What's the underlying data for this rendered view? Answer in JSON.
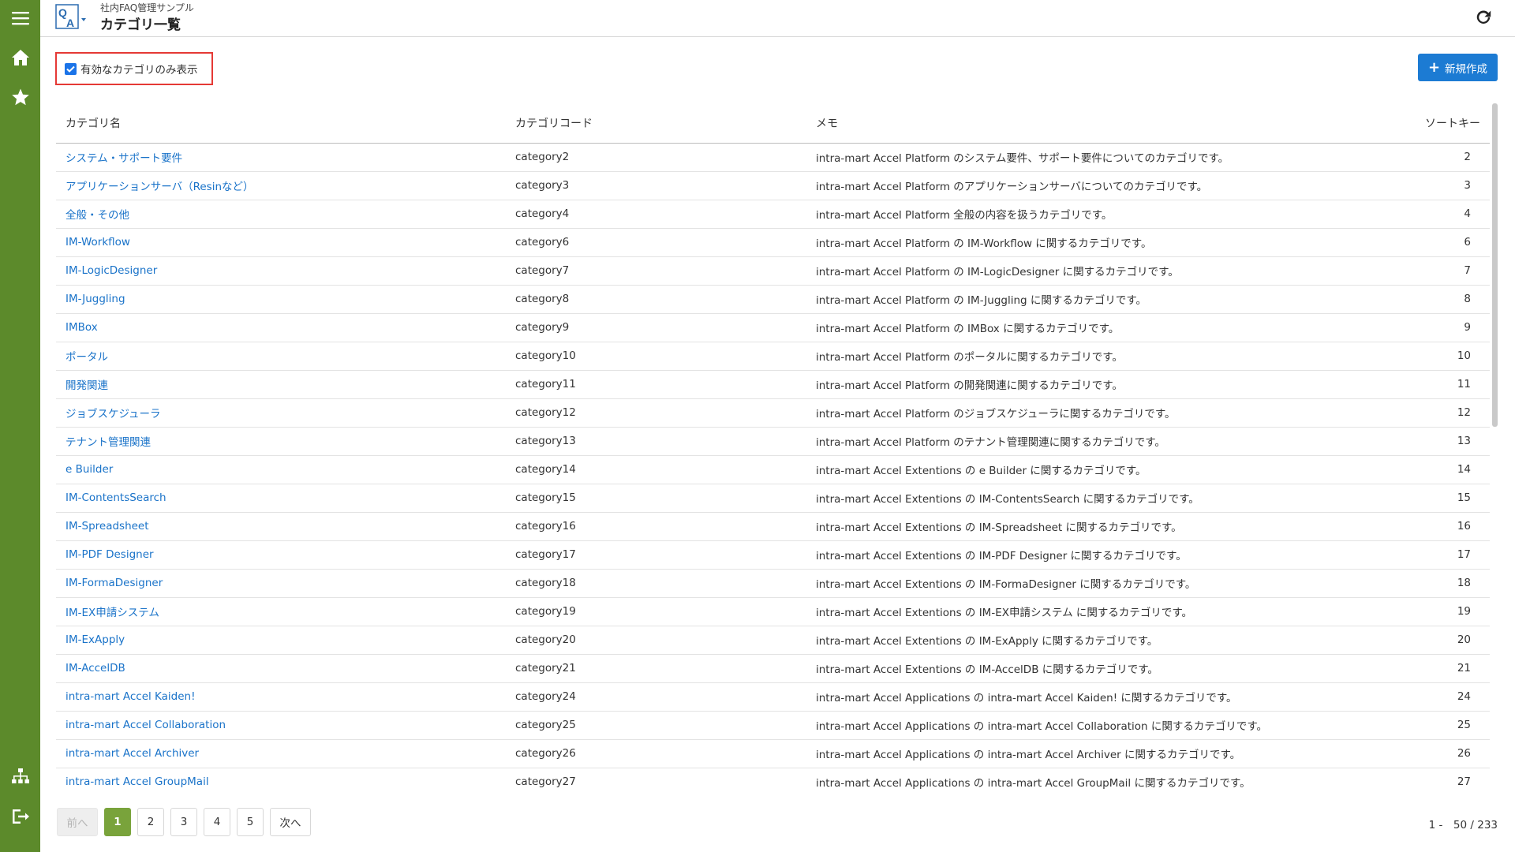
{
  "header": {
    "subtitle": "社内FAQ管理サンプル",
    "title": "カテゴリ一覧",
    "logo_text_q": "Q",
    "logo_text_a": "A"
  },
  "sidebar": {
    "items": [
      {
        "name": "menu-icon"
      },
      {
        "name": "home-icon"
      },
      {
        "name": "star-icon"
      },
      {
        "name": "sitemap-icon"
      },
      {
        "name": "logout-icon"
      }
    ],
    "color": "#5c8a2b"
  },
  "filter": {
    "label": "有効なカテゴリのみ表示",
    "checked": true
  },
  "toolbar": {
    "new_label": "新規作成",
    "accent": "#1c7bd3"
  },
  "table": {
    "headers": {
      "name": "カテゴリ名",
      "code": "カテゴリコード",
      "memo": "メモ",
      "sort": "ソートキー"
    },
    "rows": [
      {
        "name": "システム・サポート要件",
        "code": "category2",
        "memo": "intra-mart Accel Platform のシステム要件、サポート要件についてのカテゴリです。",
        "sort": "2"
      },
      {
        "name": "アプリケーションサーバ（Resinなど）",
        "code": "category3",
        "memo": "intra-mart Accel Platform のアプリケーションサーバについてのカテゴリです。",
        "sort": "3"
      },
      {
        "name": "全般・その他",
        "code": "category4",
        "memo": "intra-mart Accel Platform 全般の内容を扱うカテゴリです。",
        "sort": "4"
      },
      {
        "name": "IM-Workflow",
        "code": "category6",
        "memo": "intra-mart Accel Platform の IM-Workflow に関するカテゴリです。",
        "sort": "6"
      },
      {
        "name": "IM-LogicDesigner",
        "code": "category7",
        "memo": "intra-mart Accel Platform の IM-LogicDesigner に関するカテゴリです。",
        "sort": "7"
      },
      {
        "name": "IM-Juggling",
        "code": "category8",
        "memo": "intra-mart Accel Platform の IM-Juggling に関するカテゴリです。",
        "sort": "8"
      },
      {
        "name": "IMBox",
        "code": "category9",
        "memo": "intra-mart Accel Platform の IMBox に関するカテゴリです。",
        "sort": "9"
      },
      {
        "name": "ポータル",
        "code": "category10",
        "memo": "intra-mart Accel Platform のポータルに関するカテゴリです。",
        "sort": "10"
      },
      {
        "name": "開発関連",
        "code": "category11",
        "memo": "intra-mart Accel Platform の開発関連に関するカテゴリです。",
        "sort": "11"
      },
      {
        "name": "ジョブスケジューラ",
        "code": "category12",
        "memo": "intra-mart Accel Platform のジョブスケジューラに関するカテゴリです。",
        "sort": "12"
      },
      {
        "name": "テナント管理関連",
        "code": "category13",
        "memo": "intra-mart Accel Platform のテナント管理関連に関するカテゴリです。",
        "sort": "13"
      },
      {
        "name": "e Builder",
        "code": "category14",
        "memo": "intra-mart Accel Extentions の e Builder に関するカテゴリです。",
        "sort": "14"
      },
      {
        "name": "IM-ContentsSearch",
        "code": "category15",
        "memo": "intra-mart Accel Extentions の IM-ContentsSearch に関するカテゴリです。",
        "sort": "15"
      },
      {
        "name": "IM-Spreadsheet",
        "code": "category16",
        "memo": "intra-mart Accel Extentions の IM-Spreadsheet に関するカテゴリです。",
        "sort": "16"
      },
      {
        "name": "IM-PDF Designer",
        "code": "category17",
        "memo": "intra-mart Accel Extentions の IM-PDF Designer に関するカテゴリです。",
        "sort": "17"
      },
      {
        "name": "IM-FormaDesigner",
        "code": "category18",
        "memo": "intra-mart Accel Extentions の IM-FormaDesigner に関するカテゴリです。",
        "sort": "18"
      },
      {
        "name": "IM-EX申請システム",
        "code": "category19",
        "memo": "intra-mart Accel Extentions の IM-EX申請システム に関するカテゴリです。",
        "sort": "19"
      },
      {
        "name": "IM-ExApply",
        "code": "category20",
        "memo": "intra-mart Accel Extentions の IM-ExApply に関するカテゴリです。",
        "sort": "20"
      },
      {
        "name": "IM-AccelDB",
        "code": "category21",
        "memo": "intra-mart Accel Extentions の IM-AccelDB に関するカテゴリです。",
        "sort": "21"
      },
      {
        "name": "intra-mart Accel Kaiden!",
        "code": "category24",
        "memo": "intra-mart Accel Applications の intra-mart Accel Kaiden! に関するカテゴリです。",
        "sort": "24"
      },
      {
        "name": "intra-mart Accel Collaboration",
        "code": "category25",
        "memo": "intra-mart Accel Applications の intra-mart Accel Collaboration に関するカテゴリです。",
        "sort": "25"
      },
      {
        "name": "intra-mart Accel Archiver",
        "code": "category26",
        "memo": "intra-mart Accel Applications の intra-mart Accel Archiver に関するカテゴリです。",
        "sort": "26"
      },
      {
        "name": "intra-mart Accel GroupMail",
        "code": "category27",
        "memo": "intra-mart Accel Applications の intra-mart Accel GroupMail に関するカテゴリです。",
        "sort": "27"
      }
    ]
  },
  "pagination": {
    "prev_label": "前へ",
    "next_label": "次へ",
    "pages": [
      "1",
      "2",
      "3",
      "4",
      "5"
    ],
    "current": "1",
    "range_text": "1 -　50 / 233"
  }
}
